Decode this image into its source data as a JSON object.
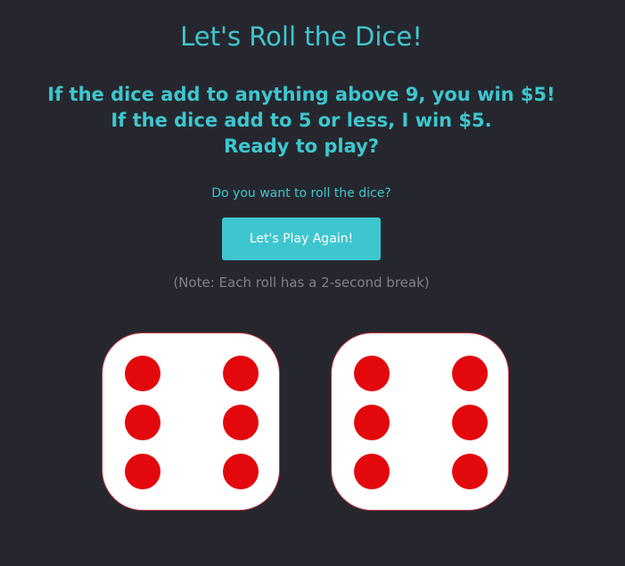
{
  "game": {
    "title": "Let's Roll the Dice!",
    "rules": [
      "If the dice add to anything above 9, you win $5!",
      "If the dice add to 5 or less, I win $5.",
      "Ready to play?"
    ],
    "prompt": "Do you want to roll the dice?",
    "play_button_label": "Let's Play Again!",
    "note": "(Note: Each roll has a 2-second break)"
  },
  "dice": [
    {
      "value": 6
    },
    {
      "value": 6
    }
  ],
  "colors": {
    "background": "#26272e",
    "accent": "#3ec6cf",
    "pip": "#e3080c",
    "die_face": "#ffffff",
    "note_text": "#80808a"
  }
}
